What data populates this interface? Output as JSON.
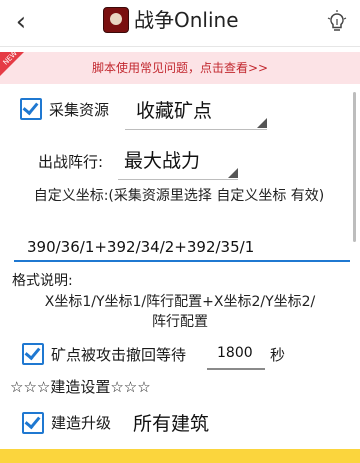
{
  "header": {
    "back_icon": "chevron-left-icon",
    "title": "战争Online",
    "bulb_icon": "lightbulb-icon"
  },
  "notice": {
    "badge": "NEW",
    "text": "脚本使用常见问题，点击查看>>"
  },
  "collect": {
    "checked": true,
    "label": "采集资源",
    "value": "收藏矿点"
  },
  "formation": {
    "label": "出战阵行:",
    "value": "最大战力"
  },
  "custom": {
    "label": "自定义坐标:(采集资源里选择 自定义坐标 有效)",
    "value": "390/36/1+392/34/2+392/35/1"
  },
  "format": {
    "title": "格式说明:",
    "line1": "X坐标1/Y坐标1/阵行配置+X坐标2/Y坐标2/",
    "line2": "阵行配置"
  },
  "retreat": {
    "checked": true,
    "label": "矿点被攻击撤回等待",
    "value": "1800",
    "unit": "秒"
  },
  "build_section": {
    "title": "☆☆☆建造设置☆☆☆"
  },
  "upgrade": {
    "checked": true,
    "label": "建造升级",
    "value": "所有建筑"
  },
  "colors": {
    "accent": "#1f78d1",
    "notice_bg": "#fce3e6",
    "notice_text": "#c2282f",
    "bottom_bar": "#fbd53d"
  }
}
